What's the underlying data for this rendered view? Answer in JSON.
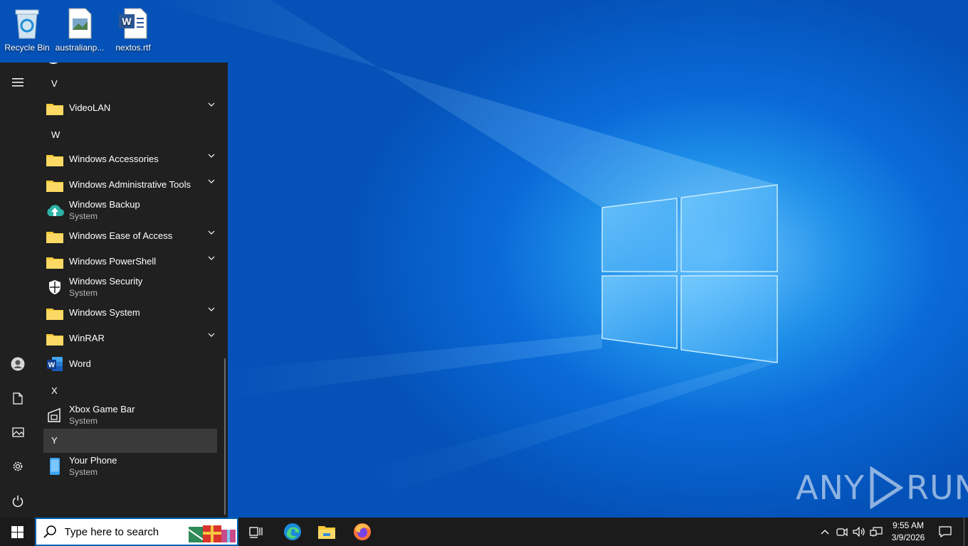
{
  "desktop": {
    "icons": [
      {
        "label": "Recycle Bin",
        "icon": "recycle-bin-icon"
      },
      {
        "label": "australianp...",
        "icon": "image-file-icon"
      },
      {
        "label": "nextos.rtf",
        "icon": "word-document-icon"
      }
    ],
    "watermark": {
      "left": "ANY",
      "right": "RUN"
    }
  },
  "start_menu": {
    "rail": [
      "hamburger-menu-icon",
      "user-account-icon",
      "documents-icon",
      "pictures-icon",
      "settings-gear-icon",
      "power-icon"
    ],
    "letters": {
      "v": "V",
      "w": "W",
      "x": "X",
      "y": "Y"
    },
    "items": {
      "videolan": {
        "label": "VideoLAN"
      },
      "win_accessories": {
        "label": "Windows Accessories"
      },
      "win_admin_tools": {
        "label": "Windows Administrative Tools"
      },
      "win_backup": {
        "label": "Windows Backup",
        "sub": "System"
      },
      "win_ease": {
        "label": "Windows Ease of Access"
      },
      "win_powershell": {
        "label": "Windows PowerShell"
      },
      "win_security": {
        "label": "Windows Security",
        "sub": "System"
      },
      "win_system": {
        "label": "Windows System"
      },
      "winrar": {
        "label": "WinRAR"
      },
      "word": {
        "label": "Word"
      },
      "xbox": {
        "label": "Xbox Game Bar",
        "sub": "System"
      },
      "your_phone": {
        "label": "Your Phone",
        "sub": "System"
      }
    }
  },
  "taskbar": {
    "search_placeholder": "Type here to search",
    "pinned": [
      "task-view-icon",
      "edge-icon",
      "file-explorer-icon",
      "firefox-icon"
    ],
    "tray": [
      "show-hidden-icons-chevron",
      "meet-now-icon",
      "volume-icon",
      "network-icon"
    ],
    "clock": {
      "time": "9:55 AM",
      "date": "3/9/2026"
    }
  },
  "colors": {
    "accent": "#0063b1",
    "menu_bg": "#202020",
    "taskbar_bg": "#1b1b1b",
    "folder": "#f8c93a"
  }
}
